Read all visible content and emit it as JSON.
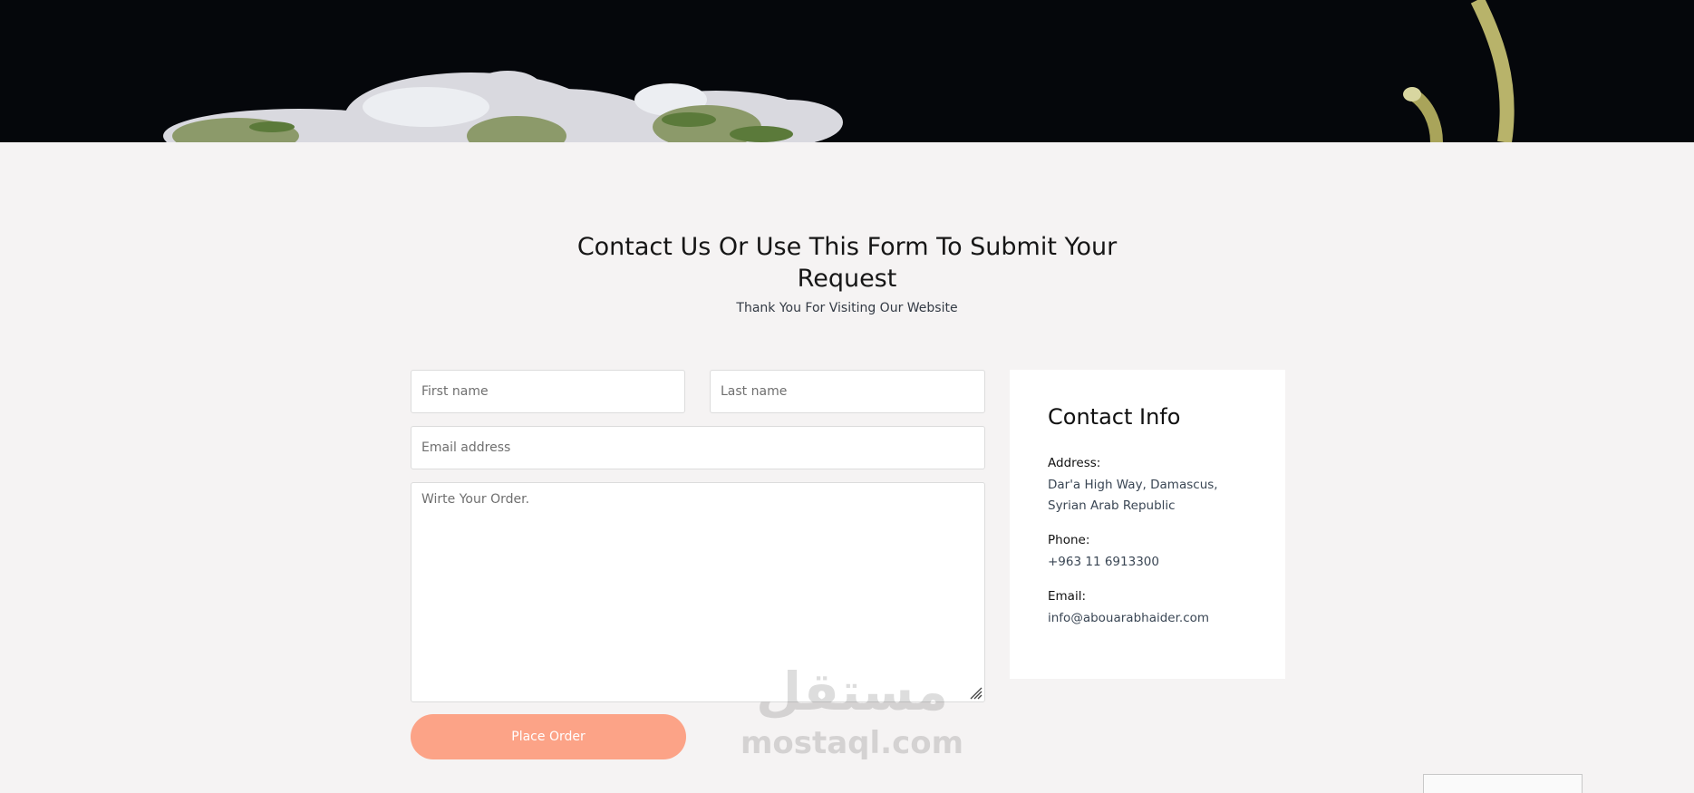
{
  "contact_section": {
    "heading": "Contact Us Or Use This Form To Submit Your Request",
    "subheading": "Thank You For Visiting Our Website"
  },
  "form": {
    "first_name_placeholder": "First name",
    "last_name_placeholder": "Last name",
    "email_placeholder": "Email address",
    "order_placeholder": "Wirte Your Order.",
    "submit_label": "Place Order"
  },
  "contact_info": {
    "title": "Contact Info",
    "address_label": "Address:",
    "address_value": "Dar'a High Way, Damascus, Syrian Arab Republic",
    "phone_label": "Phone:",
    "phone_value": "+963 11 6913300",
    "email_label": "Email:",
    "email_value": "info@abouarabhaider.com"
  },
  "watermark": {
    "arabic": "مستقل",
    "latin": "mostaql.com"
  },
  "colors": {
    "page_background": "#f5f3f3",
    "hero_background": "#05070b",
    "button": "#fca387",
    "card": "#ffffff"
  }
}
